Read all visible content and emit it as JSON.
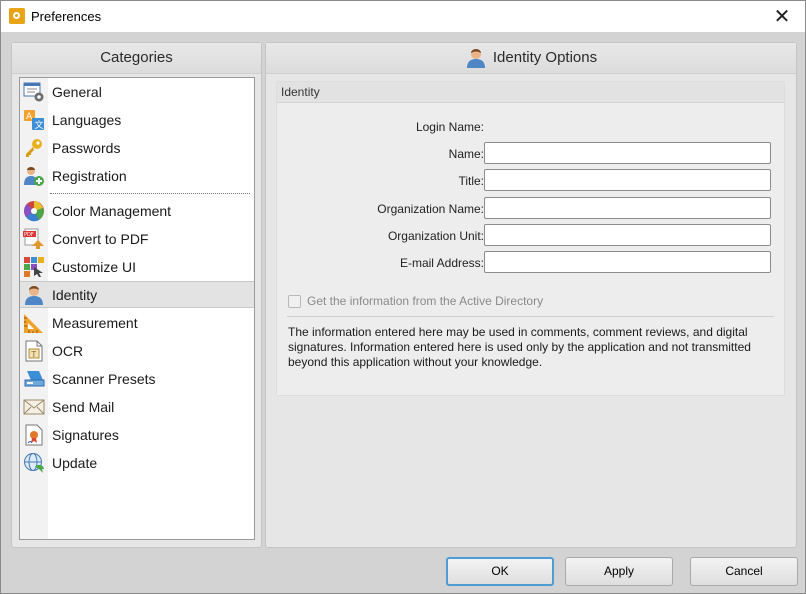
{
  "window": {
    "title": "Preferences",
    "close_glyph": "✕"
  },
  "categories": {
    "header": "Categories",
    "selected": "Identity",
    "items": [
      {
        "label": "General",
        "icon": "general-settings-icon"
      },
      {
        "label": "Languages",
        "icon": "language-translate-icon"
      },
      {
        "label": "Passwords",
        "icon": "key-icon"
      },
      {
        "label": "Registration",
        "icon": "user-add-icon"
      },
      {
        "label": "Color Management",
        "icon": "color-wheel-icon"
      },
      {
        "label": "Convert to PDF",
        "icon": "pdf-convert-icon"
      },
      {
        "label": "Customize UI",
        "icon": "customize-ui-icon"
      },
      {
        "label": "Identity",
        "icon": "user-icon"
      },
      {
        "label": "Measurement",
        "icon": "ruler-triangle-icon"
      },
      {
        "label": "OCR",
        "icon": "ocr-document-icon"
      },
      {
        "label": "Scanner Presets",
        "icon": "scanner-icon"
      },
      {
        "label": "Send Mail",
        "icon": "mail-icon"
      },
      {
        "label": "Signatures",
        "icon": "signature-document-icon"
      },
      {
        "label": "Update",
        "icon": "globe-update-icon"
      }
    ]
  },
  "options": {
    "header": "Identity Options",
    "group_title": "Identity",
    "login_name_label": "Login Name:",
    "login_name_value": "",
    "fields": [
      {
        "label": "Name:",
        "value": ""
      },
      {
        "label": "Title:",
        "value": ""
      },
      {
        "label": "Organization Name:",
        "value": ""
      },
      {
        "label": "Organization Unit:",
        "value": ""
      },
      {
        "label": "E-mail Address:",
        "value": ""
      }
    ],
    "active_directory_label": "Get the information from the Active Directory",
    "active_directory_checked": false,
    "active_directory_enabled": false,
    "info_text": "The information entered here may be used in comments, comment reviews, and digital signatures. Information entered here is used only by the application and not transmitted beyond this application without your knowledge."
  },
  "buttons": {
    "ok": "OK",
    "apply": "Apply",
    "cancel": "Cancel"
  },
  "colors": {
    "accent": "#4f9bd6",
    "app_icon": "#e8a317",
    "selected_row": "#e3e3e3"
  }
}
